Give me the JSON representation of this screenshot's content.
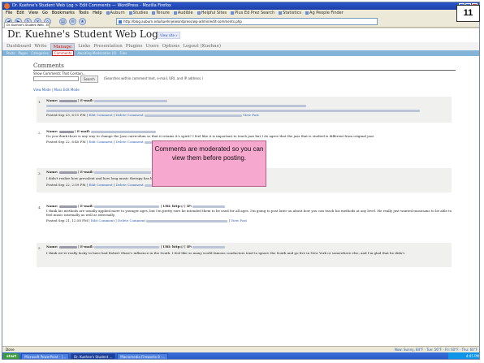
{
  "slide_number": "11",
  "browser": {
    "window_title": "Dr. Kuehne's Student Web Log > Edit Comments — WordPress - Mozilla Firefox",
    "menu": [
      "File",
      "Edit",
      "View",
      "Go",
      "Bookmarks",
      "Tools",
      "Help"
    ],
    "bookmarks": [
      "Auburn",
      "Studies",
      "Tenure",
      "Audible",
      "Helpful Sites",
      "Plus Ed Prez Search",
      "Statistics",
      "Ag People Finder"
    ],
    "url": "http://blog.auburn.edu/kuehnje/wordpress/wp-admin/edit-comments.php",
    "tab_title": "Dr. Kuehne's Student Web - Edit Com..."
  },
  "wp": {
    "site_title": "Dr. Kuehne's Student Web Log",
    "view_site": "View site »",
    "admin_tabs": [
      "Dashboard",
      "Write",
      "Manage",
      "Links",
      "Presentation",
      "Plugins",
      "Users",
      "Options",
      "Logout (Kuehne)"
    ],
    "active_admin_tab": "Manage",
    "sub_tabs": [
      "Posts",
      "Pages",
      "Categories",
      "Comments",
      "Awaiting Moderation (0)",
      "Files"
    ],
    "active_sub_tab": "Comments",
    "heading": "Comments",
    "show_label": "Show Comments That Contain...",
    "search_button": "Search",
    "search_hint": "(Searches within comment text, e-mail, URI, and IP address.)",
    "view_mode": "View Mode | Mass Edit Mode"
  },
  "comments": [
    {
      "num": "1.",
      "name_label": "Name:",
      "email_label": "| E-mail:",
      "text": "",
      "posted": "Posted Sep 23, 6:11 PM",
      "edit": "Edit Comment",
      "delete": "Delete Comment",
      "view": "View Post"
    },
    {
      "num": "2.",
      "name_label": "Name:",
      "email_label": "| E-mail:",
      "text": "Do you think there is any way to change the Jazz curriculum so that it retains it's spirit? I feel like it is important to teach jazz but I do agree that the jazz that is studied is different from original jazz.",
      "posted": "Posted Sep 22, 6:40 PM",
      "edit": "Edit Comment",
      "delete": "Delete Comment",
      "view": "View Post"
    },
    {
      "num": "3.",
      "name_label": "Name:",
      "email_label": "| E-mail:",
      "uri_label": "| URI:",
      "ip_label": "| IP:",
      "text": "I didn't realize how prevalent and how long music therapy has been around, that's really interesting.",
      "posted": "Posted Sep 22, 2:59 PM",
      "edit": "Edit Comment",
      "delete": "Delete Comment",
      "view": "View Post"
    },
    {
      "num": "4.",
      "name_label": "Name:",
      "email_label": "| E-mail:",
      "uri_label": "| URI: http://",
      "ip_label": "| IP:",
      "text": "I think his methods are usually applied more to younger ages, but I'm pretty sure he intended them to be used for all ages. I'm going to post later on about how you can teach his methods at any level. He really just wanted musicians to be able to feel music internally as well as externally.",
      "posted": "Posted Sep 21, 12:58 PM",
      "edit": "Edit Comment",
      "delete": "Delete Comment",
      "view": "View Post"
    },
    {
      "num": "5.",
      "name_label": "Name:",
      "email_label": "| E-mail:",
      "uri_label": "| URI: http://",
      "ip_label": "| IP:",
      "text": "I think we're really lucky to have had Robert Shaw's influence in the South. I feel like so many world famous conductors tend to ignore the South and go live in New York or somewhere else, and I'm glad that he didn't.",
      "posted": "",
      "edit": "",
      "delete": "",
      "view": ""
    }
  ],
  "callout": {
    "text": "Comments are moderated so you can view them before posting."
  },
  "status": {
    "left": "Done",
    "right": "Now: Sunny, 84°F · Tue: 56°F · Fri: 60°F · Thu: 60°F"
  },
  "taskbar": {
    "start": "start",
    "tasks": [
      "Microsoft PowerPoint - [...",
      "Dr. Kuehne's Student ...",
      "Macromedia Fireworks 8 -..."
    ],
    "clock": "4:05 PM"
  },
  "colors": {
    "manage_active": "#c41a1a",
    "subtab_bg": "#83b4d8",
    "callout_bg": "#f7a8cf",
    "link": "#2a5db0"
  }
}
